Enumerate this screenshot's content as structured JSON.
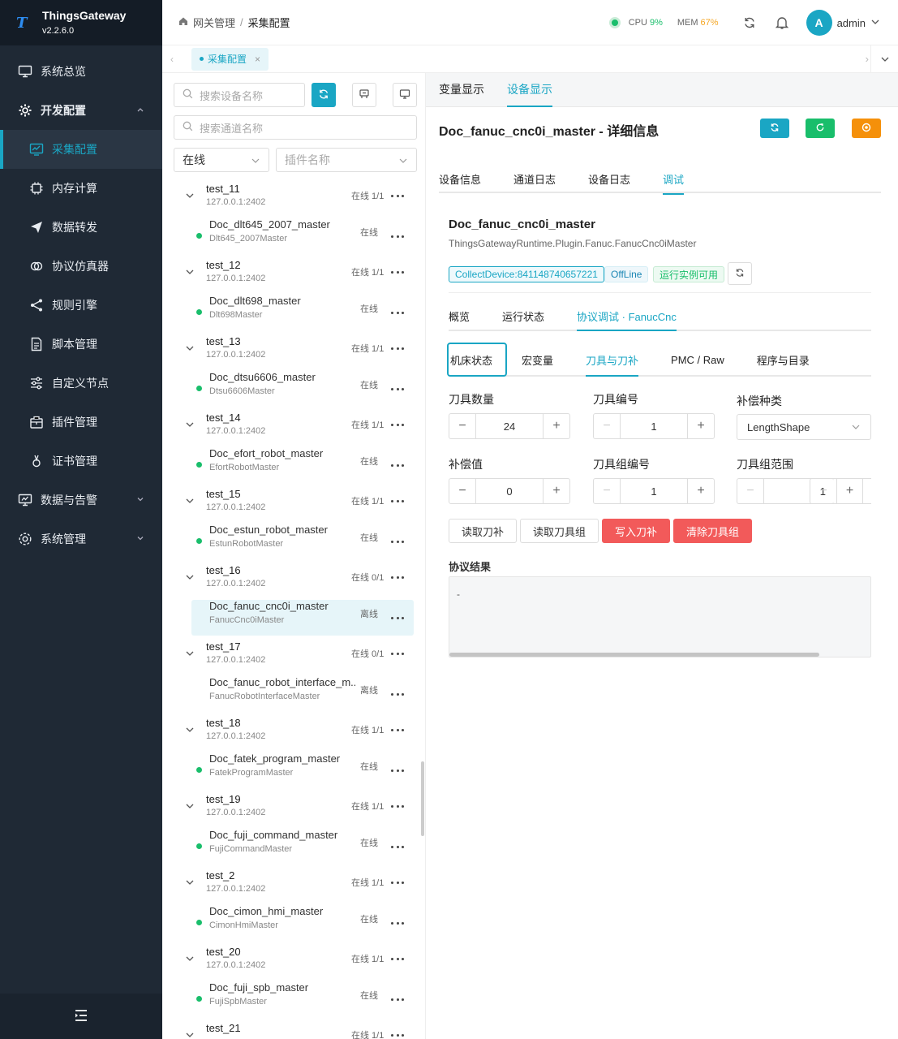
{
  "app": {
    "name": "ThingsGateway",
    "version": "v2.2.6.0"
  },
  "sidebar": {
    "items": [
      {
        "label": "系统总览"
      },
      {
        "label": "开发配置"
      },
      {
        "label": "采集配置"
      },
      {
        "label": "内存计算"
      },
      {
        "label": "数据转发"
      },
      {
        "label": "协议仿真器"
      },
      {
        "label": "规则引擎"
      },
      {
        "label": "脚本管理"
      },
      {
        "label": "自定义节点"
      },
      {
        "label": "插件管理"
      },
      {
        "label": "证书管理"
      },
      {
        "label": "数据与告警"
      },
      {
        "label": "系统管理"
      }
    ]
  },
  "header": {
    "breadcrumb": [
      "网关管理",
      "采集配置"
    ],
    "cpu_label": "CPU",
    "cpu_value": "9%",
    "mem_label": "MEM",
    "mem_value": "67%",
    "avatar_letter": "A",
    "user": "admin"
  },
  "tabs": {
    "open": "采集配置"
  },
  "left": {
    "search_device_placeholder": "搜索设备名称",
    "search_channel_placeholder": "搜索通道名称",
    "status_filter": "在线",
    "plugin_filter_placeholder": "插件名称",
    "groups": [
      {
        "name": "test_11",
        "ip": "127.0.0.1:2402",
        "status": "在线 1/1",
        "device": {
          "name": "Doc_dlt645_2007_master",
          "plugin": "Dlt645_2007Master",
          "status": "在线",
          "online": true
        }
      },
      {
        "name": "test_12",
        "ip": "127.0.0.1:2402",
        "status": "在线 1/1",
        "device": {
          "name": "Doc_dlt698_master",
          "plugin": "Dlt698Master",
          "status": "在线",
          "online": true
        }
      },
      {
        "name": "test_13",
        "ip": "127.0.0.1:2402",
        "status": "在线 1/1",
        "device": {
          "name": "Doc_dtsu6606_master",
          "plugin": "Dtsu6606Master",
          "status": "在线",
          "online": true
        }
      },
      {
        "name": "test_14",
        "ip": "127.0.0.1:2402",
        "status": "在线 1/1",
        "device": {
          "name": "Doc_efort_robot_master",
          "plugin": "EfortRobotMaster",
          "status": "在线",
          "online": true
        }
      },
      {
        "name": "test_15",
        "ip": "127.0.0.1:2402",
        "status": "在线 1/1",
        "device": {
          "name": "Doc_estun_robot_master",
          "plugin": "EstunRobotMaster",
          "status": "在线",
          "online": true
        }
      },
      {
        "name": "test_16",
        "ip": "127.0.0.1:2402",
        "status": "在线 0/1",
        "device": {
          "name": "Doc_fanuc_cnc0i_master",
          "plugin": "FanucCnc0iMaster",
          "status": "离线",
          "online": false,
          "selected": true
        }
      },
      {
        "name": "test_17",
        "ip": "127.0.0.1:2402",
        "status": "在线 0/1",
        "device": {
          "name": "Doc_fanuc_robot_interface_m...",
          "plugin": "FanucRobotInterfaceMaster",
          "status": "离线",
          "online": false
        }
      },
      {
        "name": "test_18",
        "ip": "127.0.0.1:2402",
        "status": "在线 1/1",
        "device": {
          "name": "Doc_fatek_program_master",
          "plugin": "FatekProgramMaster",
          "status": "在线",
          "online": true
        }
      },
      {
        "name": "test_19",
        "ip": "127.0.0.1:2402",
        "status": "在线 1/1",
        "device": {
          "name": "Doc_fuji_command_master",
          "plugin": "FujiCommandMaster",
          "status": "在线",
          "online": true
        }
      },
      {
        "name": "test_2",
        "ip": "127.0.0.1:2402",
        "status": "在线 1/1",
        "device": {
          "name": "Doc_cimon_hmi_master",
          "plugin": "CimonHmiMaster",
          "status": "在线",
          "online": true
        }
      },
      {
        "name": "test_20",
        "ip": "127.0.0.1:2402",
        "status": "在线 1/1",
        "device": {
          "name": "Doc_fuji_spb_master",
          "plugin": "FujiSpbMaster",
          "status": "在线",
          "online": true
        }
      },
      {
        "name": "test_21",
        "ip": "",
        "status": "在线 1/1",
        "device": null
      }
    ]
  },
  "right": {
    "top_tabs": [
      "变量显示",
      "设备显示"
    ],
    "title": "Doc_fanuc_cnc0i_master - 详细信息",
    "sub_tabs": [
      "设备信息",
      "通道日志",
      "设备日志",
      "调试"
    ],
    "device_name": "Doc_fanuc_cnc0i_master",
    "device_class": "ThingsGatewayRuntime.Plugin.Fanuc.FanucCnc0iMaster",
    "tags": [
      "CollectDevice:841148740657221",
      "OffLine",
      "运行实例可用"
    ],
    "proto_tabs": [
      "概览",
      "运行状态",
      "协议调试 · FanucCnc"
    ],
    "func_tabs": [
      "机床状态",
      "宏变量",
      "刀具与刀补",
      "PMC / Raw",
      "程序与目录"
    ],
    "fields": {
      "tool_count_label": "刀具数量",
      "tool_count": "24",
      "tool_no_label": "刀具编号",
      "tool_no": "1",
      "comp_type_label": "补偿种类",
      "comp_type": "LengthShape",
      "comp_value_label": "补偿值",
      "comp_value": "0",
      "group_no_label": "刀具组编号",
      "group_no": "1",
      "group_range_label": "刀具组范围",
      "group_range_start": "1",
      "group_range_end": "1"
    },
    "buttons": [
      "读取刀补",
      "读取刀具组",
      "写入刀补",
      "清除刀具组"
    ],
    "result_label": "协议结果",
    "result_value": "-"
  },
  "colors": {
    "accent": "#1aa6c4",
    "sidebar": "#1f2935",
    "danger": "#f25a5a",
    "online": "#19be6b"
  }
}
